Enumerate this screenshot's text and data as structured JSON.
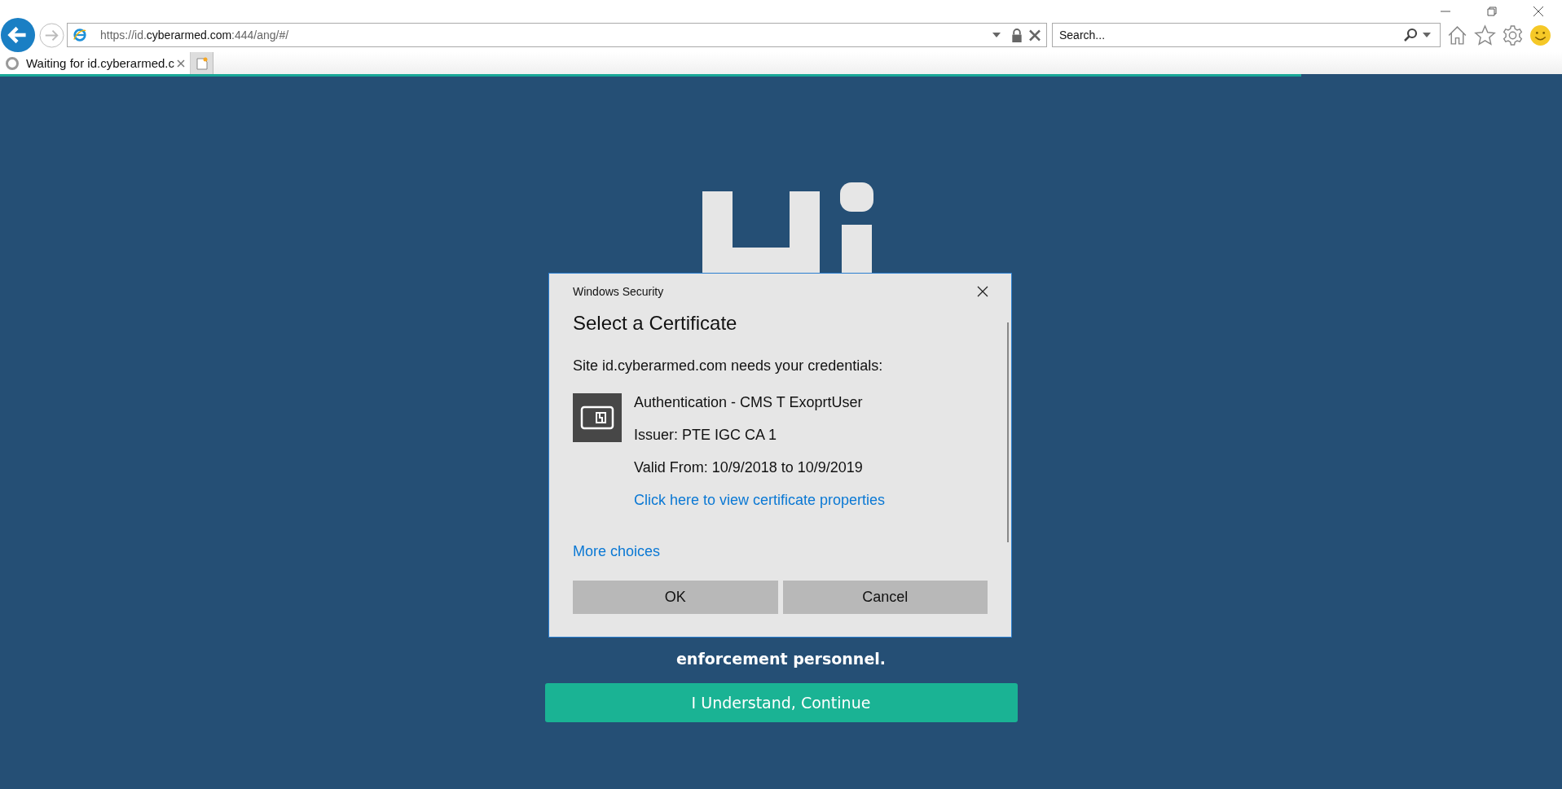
{
  "browser": {
    "address": {
      "scheme": "https://",
      "sub": "id.",
      "host": "cyberarmed.com",
      "rest": ":444/ang/#/"
    },
    "search": {
      "placeholder": "Search..."
    },
    "tabs": [
      {
        "label": "Waiting for id.cyberarmed.c",
        "loading": true,
        "selected": true
      }
    ],
    "progress": {
      "level": 0.833
    }
  },
  "page": {
    "notice_tail": "enforcement personnel.",
    "continue_button": "I Understand, Continue"
  },
  "dialog": {
    "caption": "Windows Security",
    "title": "Select a Certificate",
    "message": "Site id.cyberarmed.com needs your credentials:",
    "certificate": {
      "name": "Authentication - CMS T ExoprtUser",
      "issuer": "Issuer: PTE IGC CA 1",
      "validity": "Valid From: 10/9/2018 to 10/9/2019",
      "properties_link": "Click here to view certificate properties"
    },
    "more_choices": "More choices",
    "buttons": [
      "OK",
      "Cancel"
    ]
  }
}
